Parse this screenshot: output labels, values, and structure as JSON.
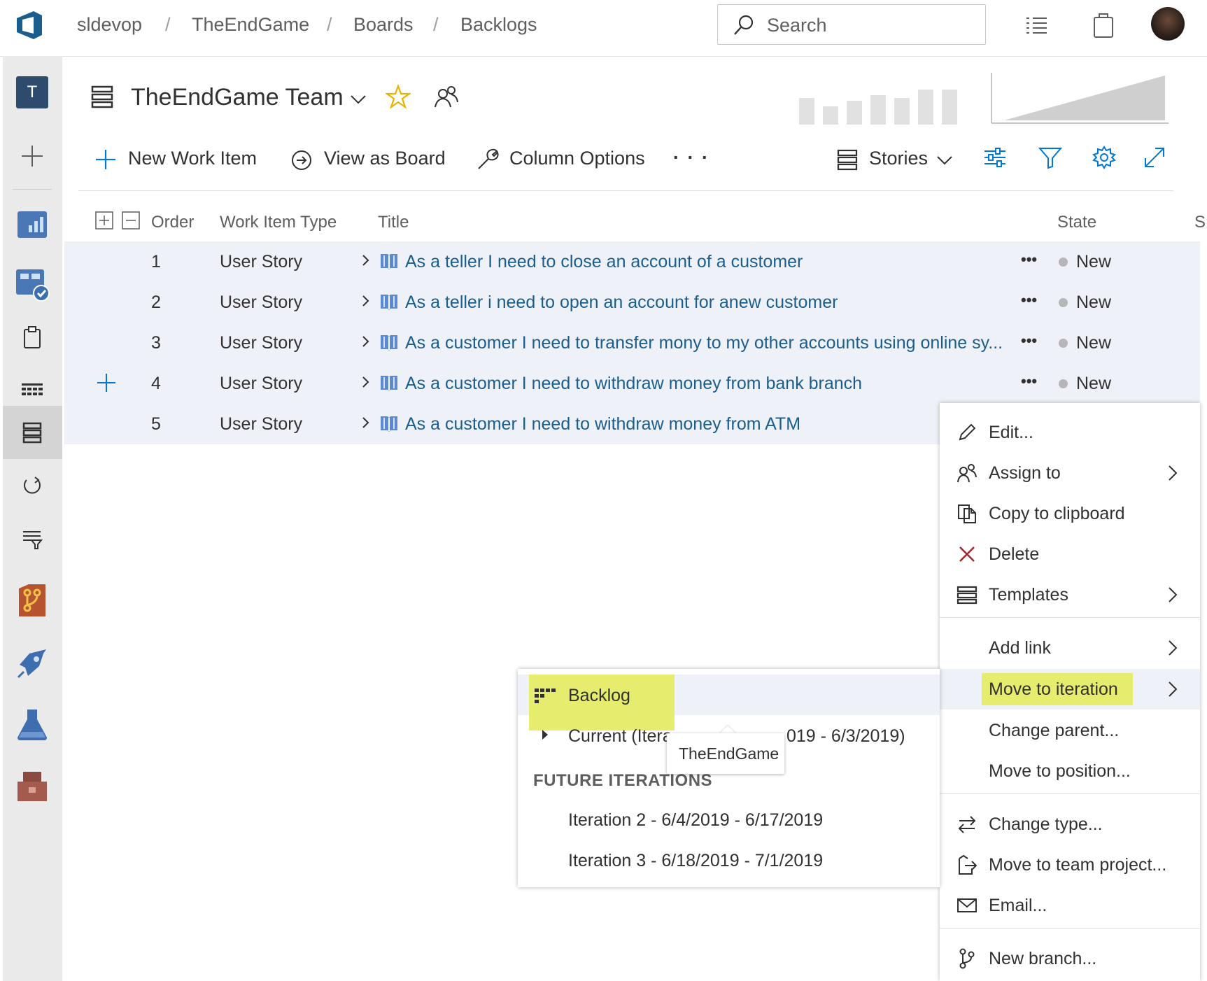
{
  "breadcrumb": {
    "org": "sldevop",
    "project": "TheEndGame",
    "section": "Boards",
    "page": "Backlogs"
  },
  "search": {
    "placeholder": "Search"
  },
  "team": {
    "name": "TheEndGame Team"
  },
  "toolbar": {
    "new_work_item": "New Work Item",
    "view_as_board": "View as Board",
    "column_options": "Column Options",
    "more": "· · ·",
    "level": "Stories"
  },
  "columns": {
    "order": "Order",
    "type": "Work Item Type",
    "title": "Title",
    "state": "State",
    "clipped": "S"
  },
  "rows": [
    {
      "order": "1",
      "type": "User Story",
      "title": "As a teller I need to close an account of a customer",
      "state": "New"
    },
    {
      "order": "2",
      "type": "User Story",
      "title": "As a teller i need to open an account for anew customer",
      "state": "New"
    },
    {
      "order": "3",
      "type": "User Story",
      "title": "As a customer I need to transfer mony to my other accounts using online sy...",
      "state": "New"
    },
    {
      "order": "4",
      "type": "User Story",
      "title": "As a customer I need to withdraw money from bank branch",
      "state": "New"
    },
    {
      "order": "5",
      "type": "User Story",
      "title": "As a customer I need to withdraw money from ATM"
    }
  ],
  "row_more": "•••",
  "context_menu": {
    "edit": "Edit...",
    "assign_to": "Assign to",
    "copy": "Copy to clipboard",
    "delete": "Delete",
    "templates": "Templates",
    "add_link": "Add link",
    "move_iteration": "Move to iteration",
    "change_parent": "Change parent...",
    "move_position": "Move to position...",
    "change_type": "Change type...",
    "move_project": "Move to team project...",
    "email": "Email...",
    "new_branch": "New branch..."
  },
  "submenu": {
    "backlog": "Backlog",
    "current_left": "Current (Itera",
    "current_right": "019 - 6/3/2019)",
    "future_header": "FUTURE ITERATIONS",
    "iteration2": "Iteration 2 - 6/4/2019 - 6/17/2019",
    "iteration3": "Iteration 3 - 6/18/2019 - 7/1/2019"
  },
  "tooltip": {
    "text": "TheEndGame"
  },
  "colors": {
    "accent": "#0078d4",
    "highlight": "#e6ec6e",
    "row_selected": "#eef1f7",
    "nav_bg": "#eaeaea",
    "delete_x": "#a4262c"
  }
}
